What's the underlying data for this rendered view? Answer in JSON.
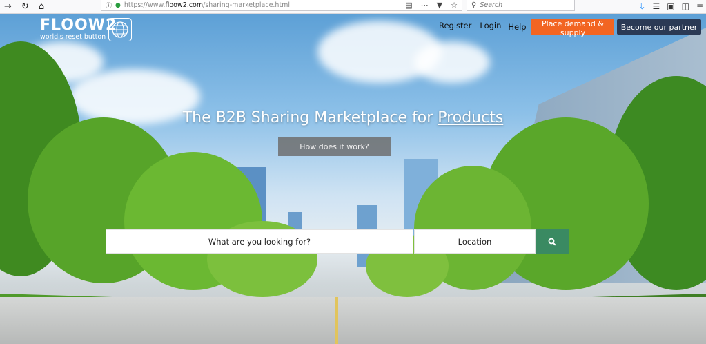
{
  "browser": {
    "url_prefix": "https://www.",
    "url_domain": "floow2.com",
    "url_path": "/sharing-marketplace.html",
    "search_placeholder": "Search"
  },
  "header": {
    "logo_word": "FLOOW2",
    "logo_tagline": "world's reset button",
    "nav": [
      "Register",
      "Login",
      "Help"
    ],
    "demand_button": "Place demand & supply",
    "partner_button": "Become our partner"
  },
  "hero": {
    "headline": "The B2B Sharing Marketplace for ",
    "headline_link": "Products",
    "how_button": "How does it work?"
  },
  "search": {
    "what_placeholder": "What are you looking for?",
    "location_placeholder": "Location"
  },
  "colors": {
    "orange": "#f26522",
    "navy": "#2b3a55",
    "green": "#3a8a62"
  }
}
